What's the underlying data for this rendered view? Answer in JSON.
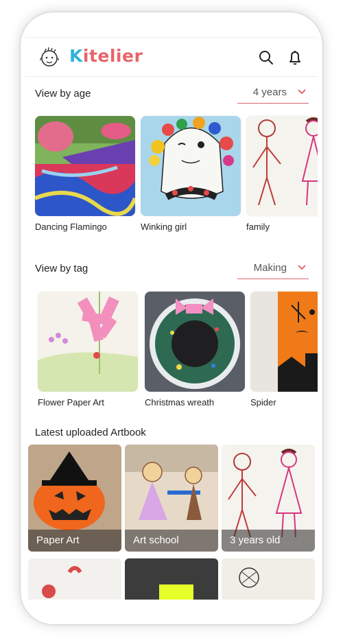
{
  "app": {
    "brand_k": "K",
    "brand_rest": "itelier"
  },
  "icons": {
    "logo": "child-face-logo",
    "search": "search-icon",
    "bell": "bell-icon",
    "chevron": "chevron-down-icon"
  },
  "colors": {
    "accent": "#e8646a",
    "brand_blue": "#2fb4d6"
  },
  "age_section": {
    "title": "View by age",
    "selected": "4 years",
    "items": [
      {
        "caption": "Dancing Flamingo"
      },
      {
        "caption": "Winking girl"
      },
      {
        "caption": "family"
      }
    ]
  },
  "tag_section": {
    "title": "View by tag",
    "selected": "Making",
    "items": [
      {
        "caption": "Flower Paper Art"
      },
      {
        "caption": "Christmas wreath"
      },
      {
        "caption": "Spider"
      }
    ]
  },
  "latest_section": {
    "title": "Latest uploaded Artbook",
    "tiles": [
      {
        "label": "Paper Art"
      },
      {
        "label": "Art school"
      },
      {
        "label": "3 years old"
      }
    ]
  }
}
